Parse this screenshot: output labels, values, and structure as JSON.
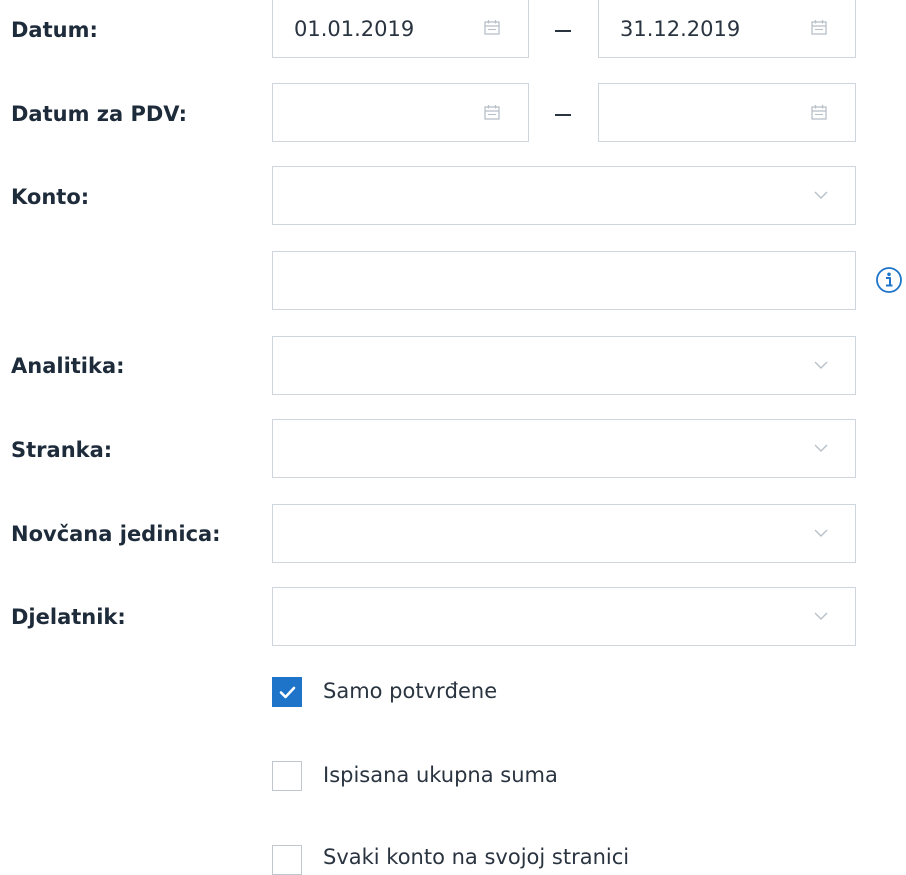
{
  "form": {
    "date": {
      "label": "Datum:",
      "from_value": "01.01.2019",
      "to_value": "31.12.2019",
      "separator": "–"
    },
    "vat_date": {
      "label": "Datum za PDV:",
      "from_value": "",
      "to_value": "",
      "separator": "–"
    },
    "account": {
      "label": "Konto:",
      "selected": "",
      "extra_value": ""
    },
    "analytics": {
      "label": "Analitika:",
      "selected": ""
    },
    "customer": {
      "label": "Stranka:",
      "selected": ""
    },
    "currency": {
      "label": "Novčana jedinica:",
      "selected": ""
    },
    "employee": {
      "label": "Djelatnik:",
      "selected": ""
    },
    "checkboxes": [
      {
        "label": "Samo potvrđene",
        "checked": true
      },
      {
        "label": "Ispisana ukupna suma",
        "checked": false
      },
      {
        "label": "Svaki konto na svojoj stranici",
        "checked": false
      }
    ]
  },
  "icons": {
    "date_picker": "calendar-icon",
    "dropdown": "chevron-down-icon",
    "info": "info-icon"
  },
  "colors": {
    "accent": "#1d74c9",
    "border": "#cfd5dc",
    "label_text": "#1e2b3a"
  }
}
